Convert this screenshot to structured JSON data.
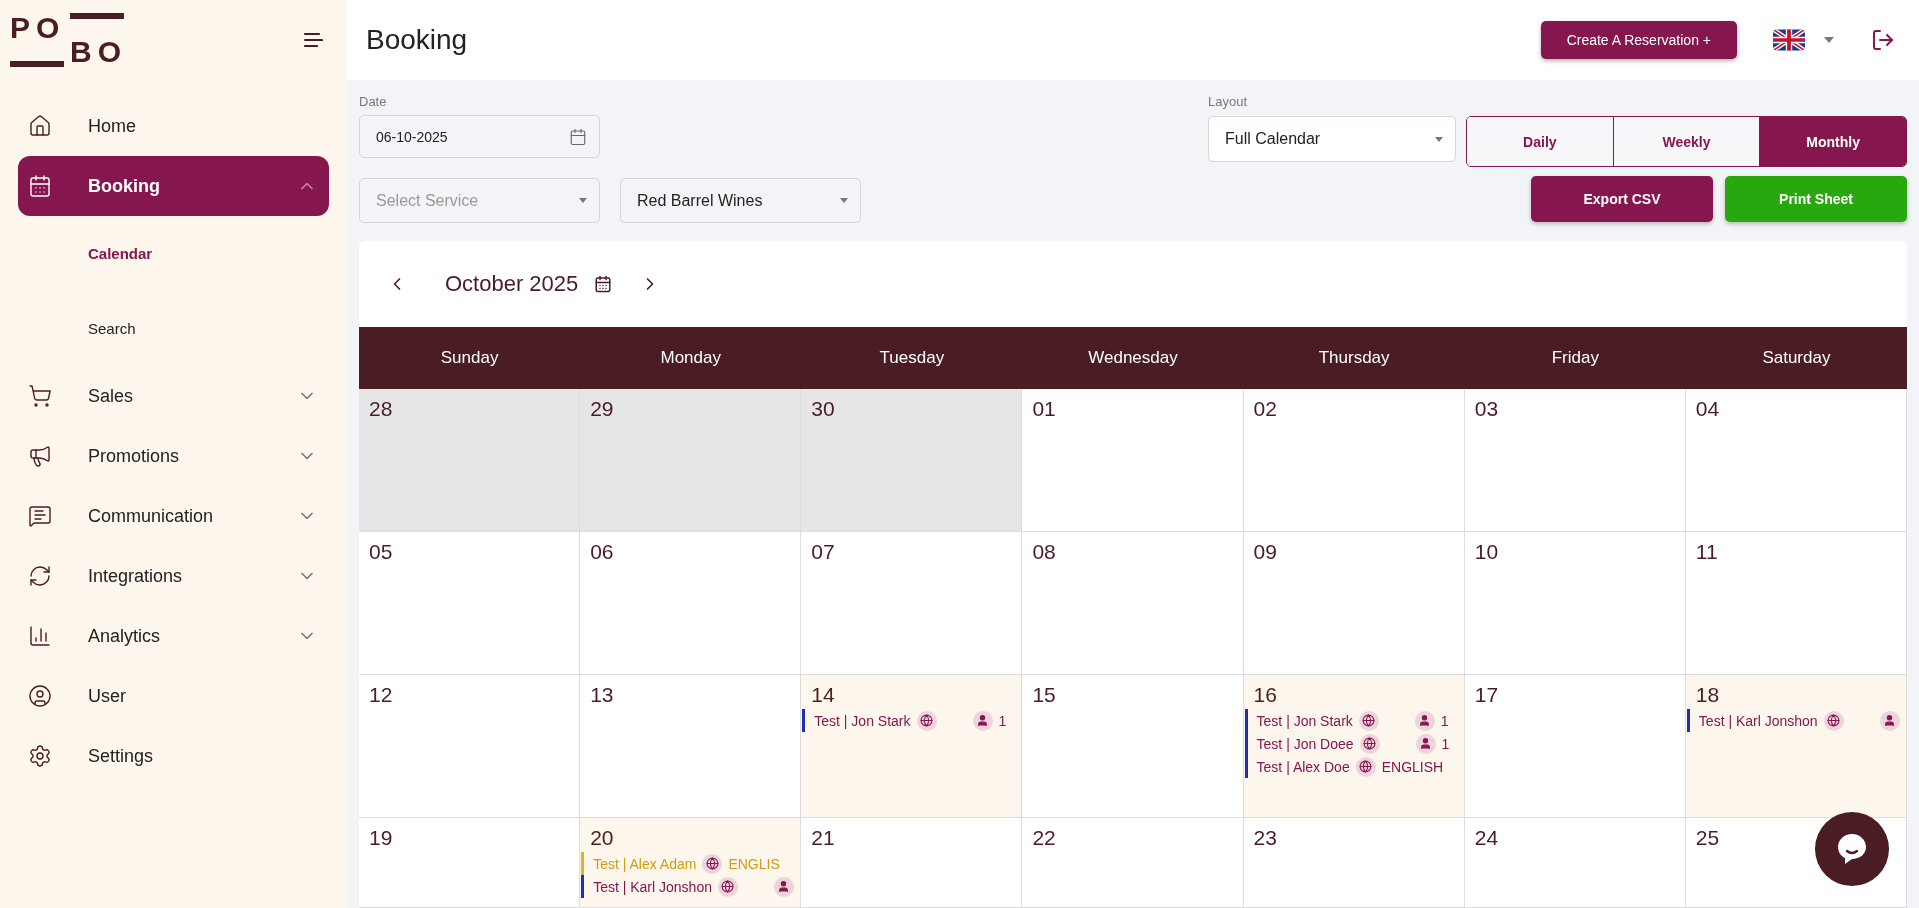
{
  "logo": {
    "top": "PO",
    "bottom": "BO"
  },
  "sidebar": {
    "items": [
      {
        "label": "Home",
        "kind": "link",
        "selected": false
      },
      {
        "label": "Booking",
        "kind": "group",
        "selected": true,
        "expanded": true,
        "children": [
          {
            "label": "Calendar",
            "selected": true
          },
          {
            "label": "Search",
            "selected": false
          }
        ]
      },
      {
        "label": "Sales",
        "kind": "group",
        "selected": false,
        "expanded": false
      },
      {
        "label": "Promotions",
        "kind": "group",
        "selected": false,
        "expanded": false
      },
      {
        "label": "Communication",
        "kind": "group",
        "selected": false,
        "expanded": false
      },
      {
        "label": "Integrations",
        "kind": "group",
        "selected": false,
        "expanded": false
      },
      {
        "label": "Analytics",
        "kind": "group",
        "selected": false,
        "expanded": false
      },
      {
        "label": "User",
        "kind": "link",
        "selected": false
      },
      {
        "label": "Settings",
        "kind": "link",
        "selected": false
      }
    ]
  },
  "header": {
    "title": "Booking",
    "create_button": "Create A Reservation +"
  },
  "filters": {
    "date_label": "Date",
    "date_value": "06-10-2025",
    "service": {
      "placeholder": "Select Service"
    },
    "venue": {
      "value": "Red Barrel Wines"
    },
    "layout_label": "Layout",
    "layout_value": "Full Calendar",
    "views": [
      {
        "label": "Daily",
        "selected": false
      },
      {
        "label": "Weekly",
        "selected": false
      },
      {
        "label": "Monthly",
        "selected": true
      }
    ],
    "export_button": "Export CSV",
    "print_button": "Print Sheet"
  },
  "calendar": {
    "month": "October 2025",
    "weekdays": [
      "Sunday",
      "Monday",
      "Tuesday",
      "Wednesday",
      "Thursday",
      "Friday",
      "Saturday"
    ],
    "weeks": [
      [
        {
          "day": "28",
          "muted": true
        },
        {
          "day": "29",
          "muted": true
        },
        {
          "day": "30",
          "muted": true
        },
        {
          "day": "01",
          "muted": false
        },
        {
          "day": "02",
          "muted": false
        },
        {
          "day": "03",
          "muted": false
        },
        {
          "day": "04",
          "muted": false
        }
      ],
      [
        {
          "day": "05",
          "muted": false
        },
        {
          "day": "06",
          "muted": false
        },
        {
          "day": "07",
          "muted": false
        },
        {
          "day": "08",
          "muted": false
        },
        {
          "day": "09",
          "muted": false
        },
        {
          "day": "10",
          "muted": false
        },
        {
          "day": "11",
          "muted": false
        }
      ],
      [
        {
          "day": "12",
          "muted": false
        },
        {
          "day": "13",
          "muted": false
        },
        {
          "day": "14",
          "muted": false,
          "events": [
            {
              "title": "Test | Jon Stark",
              "kind": "confirmed",
              "color": "#1f2fb5",
              "tail": {
                "kind": "guests",
                "text": "1"
              }
            }
          ]
        },
        {
          "day": "15",
          "muted": false
        },
        {
          "day": "16",
          "muted": false,
          "events": [
            {
              "title": "Test | Jon Stark",
              "kind": "confirmed",
              "color": "#1f2fb5",
              "tail": {
                "kind": "guests",
                "text": "1"
              }
            },
            {
              "title": "Test | Jon Doee",
              "kind": "confirmed",
              "color": "#1f2fb5",
              "tail": {
                "kind": "guests",
                "text": "1"
              }
            },
            {
              "title": "Test | Alex Doe",
              "kind": "confirmed",
              "color": "#1f2fb5",
              "tail": {
                "kind": "language",
                "text": "ENGLISH"
              }
            }
          ]
        },
        {
          "day": "17",
          "muted": false
        },
        {
          "day": "18",
          "muted": false,
          "events": [
            {
              "title": "Test | Karl Jonshon",
              "kind": "confirmed",
              "color": "#1f2fb5",
              "tail": {
                "kind": "guests"
              }
            }
          ]
        }
      ],
      [
        {
          "day": "19",
          "muted": false
        },
        {
          "day": "20",
          "muted": false,
          "events": [
            {
              "title": "Test | Alex Adam",
              "kind": "pending",
              "color": "#e0b12a",
              "tail": {
                "kind": "language",
                "text": "ENGLIS"
              }
            },
            {
              "title": "Test | Karl Jonshon",
              "kind": "confirmed",
              "color": "#1f2fb5",
              "tail": {
                "kind": "guests"
              }
            }
          ]
        },
        {
          "day": "21",
          "muted": false
        },
        {
          "day": "22",
          "muted": false
        },
        {
          "day": "23",
          "muted": false
        },
        {
          "day": "24",
          "muted": false
        },
        {
          "day": "25",
          "muted": false
        }
      ]
    ]
  }
}
